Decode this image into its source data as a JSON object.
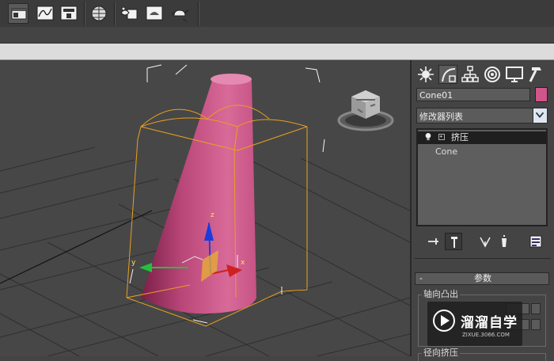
{
  "toolbar": {
    "buttons": [
      "layer-manager",
      "curve-editor",
      "schematic-view",
      "material-editor",
      "render-setup",
      "rendered-frame-window",
      "render-production"
    ]
  },
  "viewport": {
    "axis_labels": {
      "x": "x",
      "y": "y",
      "z": "z"
    },
    "object_color": "#c0507e",
    "selection_color": "#e8a020"
  },
  "command_panel": {
    "tabs": [
      "create",
      "modify",
      "hierarchy",
      "motion",
      "display",
      "utilities"
    ],
    "object_name": "Cone01",
    "object_color": "#d0558a",
    "modifier_list": "修改器列表",
    "modifier_stack": [
      {
        "label": "挤压",
        "selected": true
      },
      {
        "label": "Cone",
        "selected": false
      }
    ],
    "rollout": {
      "minus": "-",
      "title": "参数",
      "group1_label": "轴向凸出",
      "group2_label": "径向挤压"
    }
  },
  "watermark": {
    "text": "溜溜自学",
    "sub": "ZIXUE.3066.COM"
  }
}
